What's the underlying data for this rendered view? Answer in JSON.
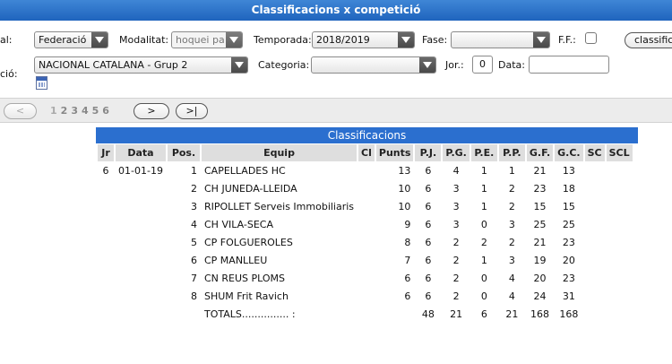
{
  "window": {
    "title": "Classificacions x competició"
  },
  "filters": {
    "row1": {
      "cut_label": "al:",
      "federacio_value": "Federació",
      "modalitat_label": "Modalitat:",
      "modalitat_value": "hoquei pa",
      "temporada_label": "Temporada:",
      "temporada_value": "2018/2019",
      "fase_label": "Fase:",
      "fase_value": "",
      "ff_label": "F.F.:",
      "classify_button": "classifica"
    },
    "row2": {
      "cut_label": "ció:",
      "competicio_value": "NACIONAL CATALANA - Grup 2",
      "categoria_label": "Categoria:",
      "categoria_value": "",
      "jor_label": "Jor.:",
      "jor_value": "0",
      "data_label": "Data:",
      "data_value": ""
    }
  },
  "pager": {
    "prev_label": "<",
    "pages": [
      "1",
      "2",
      "3",
      "4",
      "5",
      "6"
    ],
    "current_page": "1",
    "next_label": ">",
    "last_label": ">|"
  },
  "classification": {
    "title": "Classificacions",
    "headers": [
      "Jr",
      "Data",
      "Pos.",
      "Equip",
      "Cl",
      "Punts",
      "P.J.",
      "P.G.",
      "P.E.",
      "P.P.",
      "G.F.",
      "G.C.",
      "SC",
      "SCL"
    ],
    "rows": [
      {
        "jr": "6",
        "data": "01-01-19",
        "pos": "1",
        "equip": "CAPELLADES HC",
        "cl": "",
        "punts": "13",
        "pj": "6",
        "pg": "4",
        "pe": "1",
        "pp": "1",
        "gf": "21",
        "gc": "13"
      },
      {
        "jr": "",
        "data": "",
        "pos": "2",
        "equip": "CH JUNEDA-LLEIDA",
        "cl": "",
        "punts": "10",
        "pj": "6",
        "pg": "3",
        "pe": "1",
        "pp": "2",
        "gf": "23",
        "gc": "18"
      },
      {
        "jr": "",
        "data": "",
        "pos": "3",
        "equip": "RIPOLLET Serveis Immobiliaris",
        "cl": "",
        "punts": "10",
        "pj": "6",
        "pg": "3",
        "pe": "1",
        "pp": "2",
        "gf": "15",
        "gc": "15"
      },
      {
        "jr": "",
        "data": "",
        "pos": "4",
        "equip": "CH VILA-SECA",
        "cl": "",
        "punts": "9",
        "pj": "6",
        "pg": "3",
        "pe": "0",
        "pp": "3",
        "gf": "25",
        "gc": "25"
      },
      {
        "jr": "",
        "data": "",
        "pos": "5",
        "equip": "CP FOLGUEROLES",
        "cl": "",
        "punts": "8",
        "pj": "6",
        "pg": "2",
        "pe": "2",
        "pp": "2",
        "gf": "21",
        "gc": "23"
      },
      {
        "jr": "",
        "data": "",
        "pos": "6",
        "equip": "CP MANLLEU",
        "cl": "",
        "punts": "7",
        "pj": "6",
        "pg": "2",
        "pe": "1",
        "pp": "3",
        "gf": "19",
        "gc": "20"
      },
      {
        "jr": "",
        "data": "",
        "pos": "7",
        "equip": "CN REUS PLOMS",
        "cl": "",
        "punts": "6",
        "pj": "6",
        "pg": "2",
        "pe": "0",
        "pp": "4",
        "gf": "20",
        "gc": "23"
      },
      {
        "jr": "",
        "data": "",
        "pos": "8",
        "equip": "SHUM Frit Ravich",
        "cl": "",
        "punts": "6",
        "pj": "6",
        "pg": "2",
        "pe": "0",
        "pp": "4",
        "gf": "24",
        "gc": "31"
      }
    ],
    "totals": {
      "label": "TOTALS............... :",
      "pj": "48",
      "pg": "21",
      "pe": "6",
      "pp": "21",
      "gf": "168",
      "gc": "168"
    }
  },
  "colors": {
    "title_bar": "#2a70cc",
    "section_header": "#2b6fcf",
    "column_header": "#dedede"
  }
}
